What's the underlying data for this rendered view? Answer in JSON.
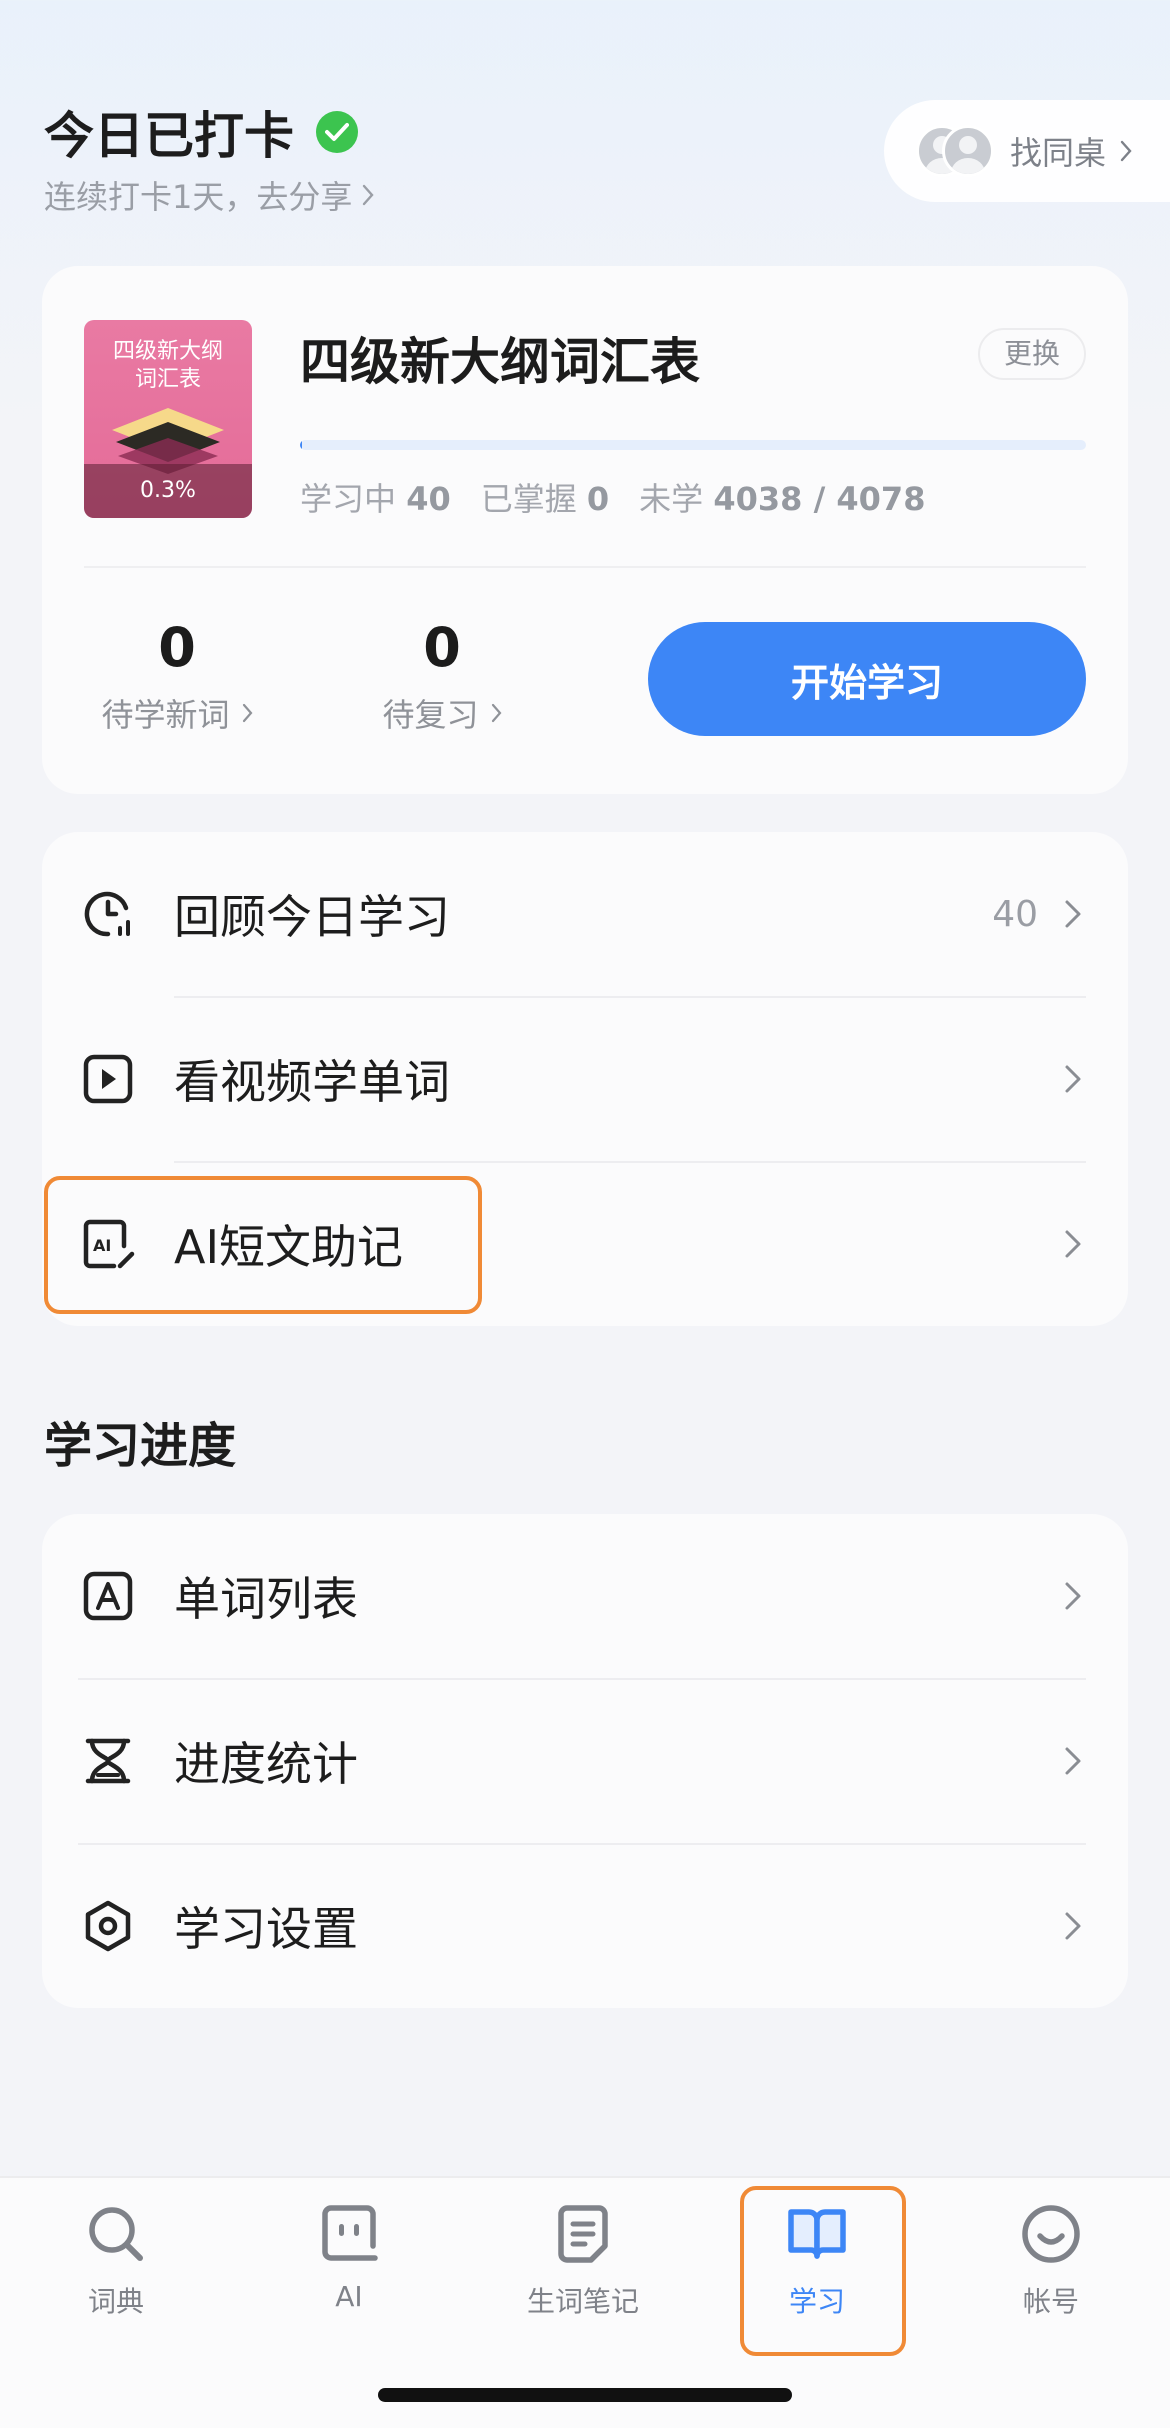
{
  "header": {
    "title": "今日已打卡",
    "streak_text": "连续打卡1天，去分享",
    "find_deskmate": "找同桌"
  },
  "book": {
    "cover_title_line1": "四级新大纲",
    "cover_title_line2": "词汇表",
    "cover_percent": "0.3%",
    "title": "四级新大纲词汇表",
    "change_label": "更换",
    "progress_fraction": 0.003,
    "learning_label": "学习中",
    "learning_count": "40",
    "mastered_label": "已掌握",
    "mastered_count": "0",
    "unlearned_label": "未学",
    "unlearned_count": "4038 / 4078"
  },
  "counters": {
    "new_words_count": "0",
    "new_words_label": "待学新词",
    "review_count": "0",
    "review_label": "待复习"
  },
  "start_button": "开始学习",
  "menu": {
    "review_today": "回顾今日学习",
    "review_today_count": "40",
    "video_words": "看视频学单词",
    "ai_mnemonic": "AI短文助记"
  },
  "progress_section": {
    "title": "学习进度",
    "word_list": "单词列表",
    "progress_stats": "进度统计",
    "study_settings": "学习设置"
  },
  "tabbar": {
    "dictionary": "词典",
    "ai": "AI",
    "notebook": "生词笔记",
    "study": "学习",
    "account": "帐号"
  },
  "colors": {
    "accent": "#3d86f6",
    "highlight": "#f08a36",
    "check": "#3cc44f",
    "cover": "#e46b98"
  }
}
